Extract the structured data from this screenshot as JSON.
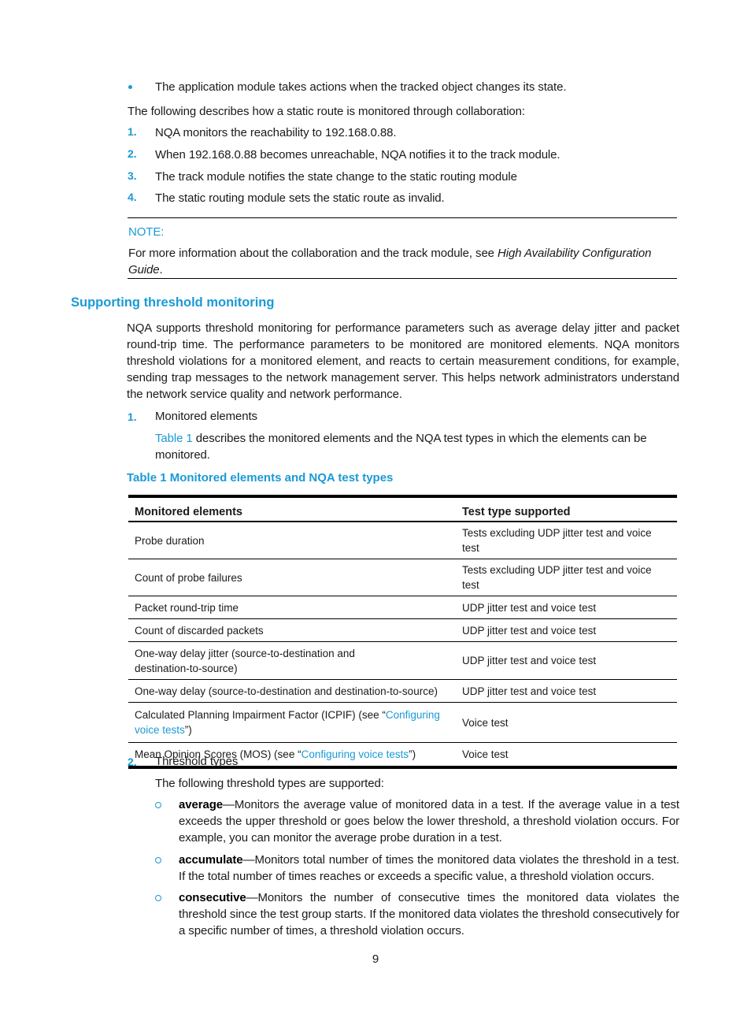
{
  "intro_bullet": "The application module takes actions when the tracked object changes its state.",
  "collab_intro": "The following describes how a static route is monitored through collaboration:",
  "steps": [
    {
      "num": "1.",
      "text": "NQA monitors the reachability to 192.168.0.88."
    },
    {
      "num": "2.",
      "text": "When 192.168.0.88 becomes unreachable, NQA notifies it to the track module."
    },
    {
      "num": "3.",
      "text": "The track module notifies the state change to the static routing module"
    },
    {
      "num": "4.",
      "text": "The static routing module sets the static route as invalid."
    }
  ],
  "note": {
    "label": "NOTE:",
    "text_before": "For more information about the collaboration and the track module, see ",
    "italic": "High Availability Configuration Guide",
    "text_after": "."
  },
  "section": {
    "heading": "Supporting threshold monitoring",
    "paragraph": "NQA supports threshold monitoring for performance parameters such as average delay jitter and packet round-trip time. The performance parameters to be monitored are monitored elements. NQA monitors threshold violations for a monitored element, and reacts to certain measurement conditions, for example, sending trap messages to the network management server. This helps network administrators understand the network service quality and network performance."
  },
  "item1": {
    "num": "1.",
    "label": "Monitored elements",
    "link": "Table 1",
    "desc": " describes the monitored elements and the NQA test types in which the elements can be monitored."
  },
  "table": {
    "caption": "Table 1 Monitored elements and NQA test types",
    "headers": [
      "Monitored elements",
      "Test type supported"
    ],
    "rows": [
      {
        "element": "Probe duration",
        "test": "Tests excluding UDP jitter test and voice test"
      },
      {
        "element": "Count of probe failures",
        "test": "Tests excluding UDP jitter test and voice test"
      },
      {
        "element": "Packet round-trip time",
        "test": "UDP jitter test and voice test"
      },
      {
        "element": "Count of discarded packets",
        "test": "UDP jitter test and voice test"
      },
      {
        "element": "One-way delay jitter (source-to-destination and destination-to-source)",
        "test": "UDP jitter test and voice test"
      },
      {
        "element": "One-way delay (source-to-destination and destination-to-source)",
        "test": "UDP jitter test and voice test"
      },
      {
        "element_before": "Calculated Planning Impairment Factor (ICPIF) (see “",
        "element_link": "Configuring voice tests",
        "element_after": "”)",
        "test": "Voice test"
      },
      {
        "element_before": "Mean Opinion Scores (MOS) (see “",
        "element_link": "Configuring voice tests",
        "element_after": "”)",
        "test": "Voice test"
      }
    ]
  },
  "item2": {
    "num": "2.",
    "label": "Threshold types",
    "intro": "The following threshold types are supported:",
    "types": [
      {
        "term": "average",
        "desc": "—Monitors the average value of monitored data in a test. If the average value in a test exceeds the upper threshold or goes below the lower threshold, a threshold violation occurs. For example, you can monitor the average probe duration in a test."
      },
      {
        "term": "accumulate",
        "desc": "—Monitors total number of times the monitored data violates the threshold in a test. If the total number of times reaches or exceeds a specific value, a threshold violation occurs."
      },
      {
        "term": "consecutive",
        "desc": "—Monitors the number of consecutive times the monitored data violates the threshold since the test group starts. If the monitored data violates the threshold consecutively for a specific number of times, a threshold violation occurs."
      }
    ]
  },
  "page_number": "9"
}
